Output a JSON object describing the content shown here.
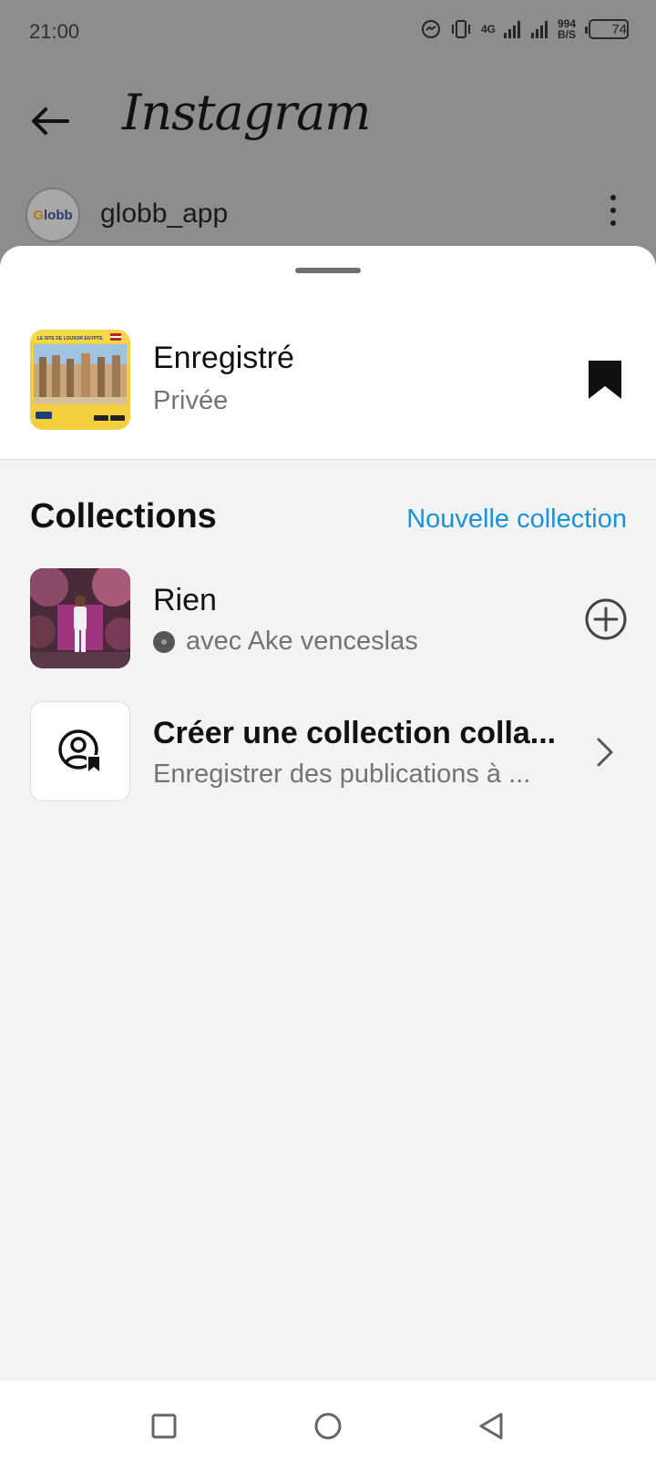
{
  "status_bar": {
    "time": "21:00",
    "network": "4G",
    "net_speed_value": "994",
    "net_speed_unit": "B/S",
    "battery": "74",
    "battery_level_pct": 74
  },
  "header": {
    "app_name": "Instagram"
  },
  "post": {
    "avatar_text_g": "G",
    "avatar_text_rest": "lobb",
    "username": "globb_app"
  },
  "sheet": {
    "saved": {
      "title": "Enregistré",
      "subtitle": "Privée",
      "thumb_caption": "LE SITE DE LOUXOR ÉGYPTE"
    },
    "collections_heading": "Collections",
    "new_collection_label": "Nouvelle collection",
    "collections": [
      {
        "title": "Rien",
        "subtitle": "avec Ake venceslas"
      }
    ],
    "create_collab": {
      "title": "Créer une collection colla...",
      "subtitle": "Enregistrer des publications à ..."
    }
  },
  "colors": {
    "accent": "#1a91d8",
    "sheet_bg": "#f3f3f3",
    "dim_bg": "#8d8d8d"
  },
  "icons": {
    "back": "arrow-left-icon",
    "more": "more-vertical-icon",
    "bookmark": "bookmark-filled-icon",
    "add": "plus-circle-icon",
    "collab": "person-bookmark-icon",
    "chevron": "chevron-right-icon",
    "nav_recent": "square-icon",
    "nav_home": "circle-icon",
    "nav_back": "triangle-back-icon"
  }
}
